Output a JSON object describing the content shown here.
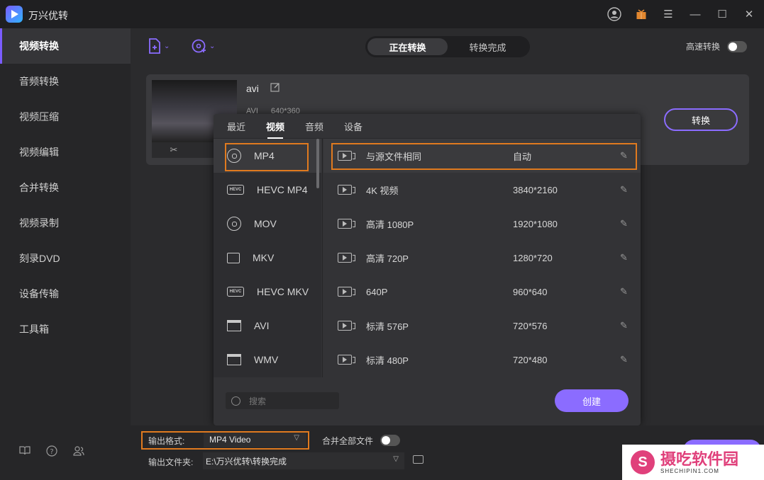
{
  "app": {
    "title": "万兴优转"
  },
  "sidebar": {
    "items": [
      {
        "label": "视频转换",
        "active": true
      },
      {
        "label": "音频转换"
      },
      {
        "label": "视频压缩"
      },
      {
        "label": "视频编辑"
      },
      {
        "label": "合并转换"
      },
      {
        "label": "视频录制"
      },
      {
        "label": "刻录DVD"
      },
      {
        "label": "设备传输"
      },
      {
        "label": "工具箱"
      }
    ]
  },
  "toolbar": {
    "tabs": [
      {
        "label": "正在转换",
        "active": true
      },
      {
        "label": "转换完成"
      }
    ],
    "speed_label": "高速转换"
  },
  "file": {
    "name": "avi",
    "format": "AVI",
    "resolution": "640*360",
    "convert_label": "转换"
  },
  "popup": {
    "tabs": [
      {
        "label": "最近"
      },
      {
        "label": "视频",
        "active": true
      },
      {
        "label": "音频"
      },
      {
        "label": "设备"
      }
    ],
    "formats": [
      {
        "label": "MP4",
        "icon": "disc-icon",
        "selected": true
      },
      {
        "label": "HEVC MP4",
        "icon": "hevc-icon"
      },
      {
        "label": "MOV",
        "icon": "disc-icon"
      },
      {
        "label": "MKV",
        "icon": "camera-icon"
      },
      {
        "label": "HEVC MKV",
        "icon": "hevc-icon"
      },
      {
        "label": "AVI",
        "icon": "clapper-icon"
      },
      {
        "label": "WMV",
        "icon": "clapper-icon"
      }
    ],
    "presets": [
      {
        "name": "与源文件相同",
        "value": "自动",
        "selected": true
      },
      {
        "name": "4K 视频",
        "value": "3840*2160"
      },
      {
        "name": "高清 1080P",
        "value": "1920*1080"
      },
      {
        "name": "高清 720P",
        "value": "1280*720"
      },
      {
        "name": "640P",
        "value": "960*640"
      },
      {
        "name": "标清 576P",
        "value": "720*576"
      },
      {
        "name": "标清 480P",
        "value": "720*480"
      }
    ],
    "search_placeholder": "搜索",
    "create_label": "创建"
  },
  "bottom": {
    "output_format_label": "输出格式:",
    "output_format_value": "MP4 Video",
    "merge_label": "合并全部文件",
    "output_folder_label": "输出文件夹:",
    "output_folder_value": "E:\\万兴优转\\转换完成"
  },
  "watermark": {
    "cn": "摄吃软件园",
    "en": "SHECHIPIN1.COM"
  },
  "colors": {
    "accent": "#8b6cff",
    "highlight": "#e07a1f"
  }
}
